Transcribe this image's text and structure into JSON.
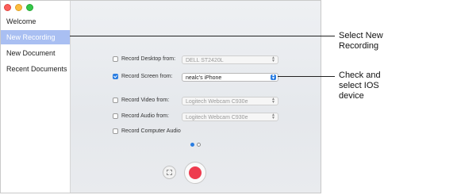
{
  "sidebar": {
    "items": [
      {
        "label": "Welcome"
      },
      {
        "label": "New Recording"
      },
      {
        "label": "New Document"
      },
      {
        "label": "Recent Documents"
      }
    ]
  },
  "options": [
    {
      "label": "Record Desktop from:",
      "checked": false,
      "value": "DELL ST2420L",
      "has_select": true
    },
    {
      "label": "Record Screen from:",
      "checked": true,
      "value": "nealc's iPhone",
      "has_select": true
    },
    {
      "label": "Record Video from:",
      "checked": false,
      "value": "Logitech Webcam C930e",
      "has_select": true
    },
    {
      "label": "Record Audio from:",
      "checked": false,
      "value": "Logitech Webcam C930e",
      "has_select": true
    },
    {
      "label": "Record Computer Audio",
      "checked": false,
      "has_select": false
    }
  ],
  "callouts": {
    "select_new_recording": [
      "Select New",
      "Recording"
    ],
    "check_select_ios": [
      "Check and",
      "select IOS",
      "device"
    ]
  },
  "colors": {
    "selected_sidebar": "#a9bff2",
    "accent": "#2a7de1",
    "record": "#ee3b4e"
  }
}
